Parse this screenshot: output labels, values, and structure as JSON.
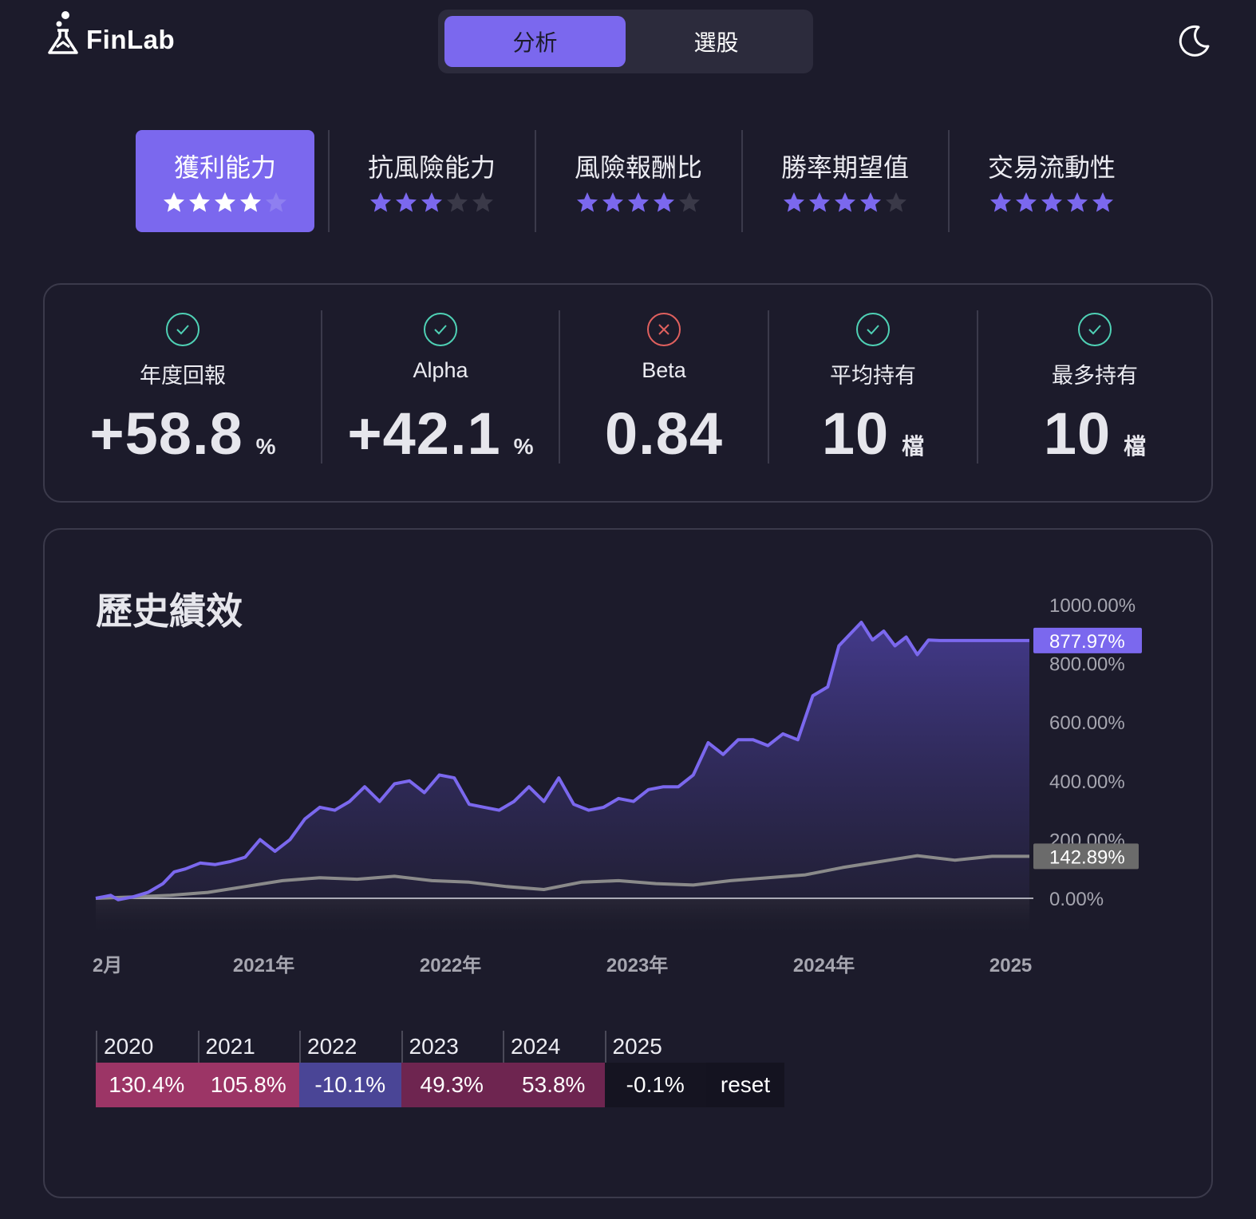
{
  "header": {
    "brand": "FinLab",
    "mode_tabs": [
      {
        "label": "分析",
        "active": true
      },
      {
        "label": "選股",
        "active": false
      }
    ],
    "theme_icon": "moon-icon"
  },
  "ratings": [
    {
      "label": "獲利能力",
      "stars": 4,
      "active": true
    },
    {
      "label": "抗風險能力",
      "stars": 3,
      "active": false
    },
    {
      "label": "風險報酬比",
      "stars": 4,
      "active": false
    },
    {
      "label": "勝率期望值",
      "stars": 4,
      "active": false
    },
    {
      "label": "交易流動性",
      "stars": 5,
      "active": false
    }
  ],
  "metrics": [
    {
      "label": "年度回報",
      "value": "+58.8",
      "unit": "%",
      "status": "pass"
    },
    {
      "label": "Alpha",
      "value": "+42.1",
      "unit": "%",
      "status": "pass"
    },
    {
      "label": "Beta",
      "value": "0.84",
      "unit": "",
      "status": "fail"
    },
    {
      "label": "平均持有",
      "value": "10",
      "unit": "檔",
      "status": "pass"
    },
    {
      "label": "最多持有",
      "value": "10",
      "unit": "檔",
      "status": "pass"
    }
  ],
  "colors": {
    "background": "#1c1b2b",
    "accent": "#7b68ee",
    "pass": "#4fd1b5",
    "fail": "#e0605e",
    "benchmark": "#8a8a8a",
    "star_off": "#3a3948"
  },
  "chart": {
    "title": "歷史績效",
    "strategy_last_label": "877.97%",
    "benchmark_last_label": "142.89%",
    "year_table": [
      {
        "year": "2020",
        "return": "130.4%",
        "color": "#9c3566"
      },
      {
        "year": "2021",
        "return": "105.8%",
        "color": "#9c3566"
      },
      {
        "year": "2022",
        "return": "-10.1%",
        "color": "#4a4596"
      },
      {
        "year": "2023",
        "return": "49.3%",
        "color": "#6e2550"
      },
      {
        "year": "2024",
        "return": "53.8%",
        "color": "#6e2550"
      },
      {
        "year": "2025",
        "return": "-0.1%",
        "color": "#151421"
      }
    ],
    "reset_label": "reset"
  },
  "chart_data": {
    "type": "area",
    "title": "歷史績效",
    "x_tick_labels": [
      "2月",
      "2021年",
      "2022年",
      "2023年",
      "2024年",
      "2025"
    ],
    "y_tick_labels": [
      "1000.00%",
      "800.00%",
      "600.00%",
      "400.00%",
      "200.00%",
      "0.00%"
    ],
    "ylim": [
      0,
      1000
    ],
    "grid": false,
    "x_range": [
      "2020-02",
      "2025-02"
    ],
    "series": [
      {
        "color": "#7b68ee",
        "x": [
          2020.1,
          2020.18,
          2020.22,
          2020.3,
          2020.38,
          2020.46,
          2020.52,
          2020.58,
          2020.66,
          2020.74,
          2020.82,
          2020.9,
          2020.98,
          2021.06,
          2021.14,
          2021.22,
          2021.3,
          2021.38,
          2021.46,
          2021.54,
          2021.62,
          2021.7,
          2021.78,
          2021.86,
          2021.94,
          2022.02,
          2022.1,
          2022.18,
          2022.26,
          2022.34,
          2022.42,
          2022.5,
          2022.58,
          2022.66,
          2022.74,
          2022.82,
          2022.9,
          2022.98,
          2023.06,
          2023.14,
          2023.22,
          2023.3,
          2023.38,
          2023.46,
          2023.54,
          2023.62,
          2023.7,
          2023.78,
          2023.86,
          2023.94,
          2024.02,
          2024.08,
          2024.14,
          2024.2,
          2024.26,
          2024.32,
          2024.38,
          2024.44,
          2024.5,
          2024.56,
          2024.62,
          2024.68,
          2024.74,
          2024.8,
          2024.86,
          2024.92,
          2024.98,
          2025.04,
          2025.1
        ],
        "y": [
          0,
          10,
          -5,
          5,
          20,
          50,
          90,
          100,
          120,
          115,
          125,
          140,
          200,
          160,
          200,
          270,
          310,
          300,
          330,
          380,
          330,
          390,
          400,
          360,
          420,
          410,
          320,
          310,
          300,
          330,
          380,
          330,
          410,
          320,
          300,
          310,
          340,
          330,
          370,
          380,
          380,
          420,
          530,
          490,
          540,
          540,
          520,
          560,
          540,
          690,
          720,
          860,
          900,
          940,
          880,
          910,
          860,
          890,
          830,
          880,
          877.97,
          877.97,
          877.97,
          877.97,
          877.97,
          877.97,
          877.97,
          877.97,
          877.97
        ]
      },
      {
        "color": "#8a8a8a",
        "x": [
          2020.1,
          2020.3,
          2020.5,
          2020.7,
          2020.9,
          2021.1,
          2021.3,
          2021.5,
          2021.7,
          2021.9,
          2022.1,
          2022.3,
          2022.5,
          2022.7,
          2022.9,
          2023.1,
          2023.3,
          2023.5,
          2023.7,
          2023.9,
          2024.1,
          2024.3,
          2024.5,
          2024.7,
          2024.9,
          2025.1
        ],
        "y": [
          0,
          5,
          10,
          20,
          40,
          60,
          70,
          65,
          75,
          60,
          55,
          40,
          30,
          55,
          60,
          50,
          45,
          60,
          70,
          80,
          105,
          125,
          145,
          130,
          142.89,
          142.89
        ]
      }
    ]
  }
}
